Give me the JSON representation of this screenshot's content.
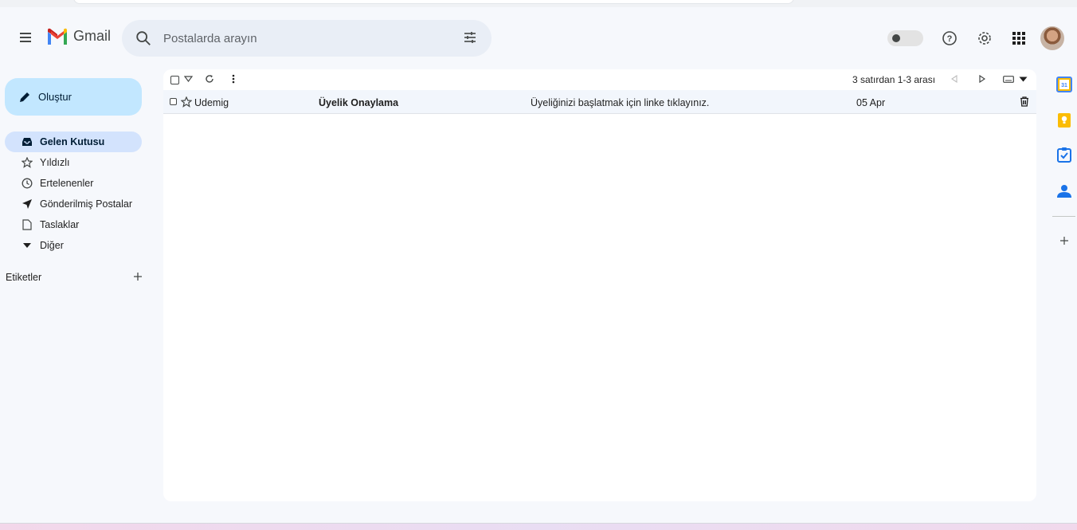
{
  "app": {
    "name": "Gmail"
  },
  "search": {
    "placeholder": "Postalarda arayın"
  },
  "compose": {
    "label": "Oluştur"
  },
  "sidebar": {
    "items": [
      {
        "label": "Gelen Kutusu",
        "icon": "inbox-icon",
        "active": true
      },
      {
        "label": "Yıldızlı",
        "icon": "star-icon"
      },
      {
        "label": "Ertelenenler",
        "icon": "clock-icon"
      },
      {
        "label": "Gönderilmiş Postalar",
        "icon": "send-icon"
      },
      {
        "label": "Taslaklar",
        "icon": "draft-icon"
      },
      {
        "label": "Diğer",
        "icon": "expand-more-icon"
      }
    ],
    "labels_heading": "Etiketler"
  },
  "toolbar": {
    "pager_text": "3 satırdan 1-3 arası"
  },
  "emails": [
    {
      "sender": "Udemig",
      "subject": "Üyelik Onaylama",
      "snippet": "Üyeliğinizi başlatmak için linke tıklayınız.",
      "date": "05 Apr"
    }
  ],
  "colors": {
    "background": "#f6f8fc",
    "compose": "#c2e7ff",
    "active_nav": "#d3e3fd",
    "search": "#e9eef6",
    "gmail_red": "#ea4335",
    "gmail_blue": "#4285f4",
    "gmail_green": "#34a853",
    "gmail_yellow": "#fbbc04"
  },
  "side_panel": {
    "calendar_day": "31"
  }
}
